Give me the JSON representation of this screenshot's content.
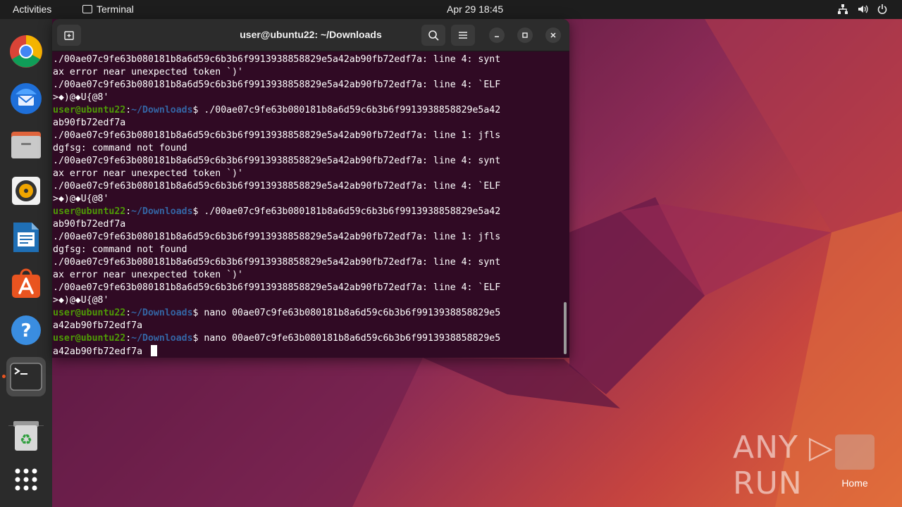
{
  "topbar": {
    "activities": "Activities",
    "app_name": "Terminal",
    "clock": "Apr 29  18:45"
  },
  "dock": {
    "items": [
      {
        "name": "chrome-icon"
      },
      {
        "name": "thunderbird-icon"
      },
      {
        "name": "files-icon"
      },
      {
        "name": "rhythmbox-icon"
      },
      {
        "name": "writer-icon"
      },
      {
        "name": "app-center-icon"
      },
      {
        "name": "help-icon"
      },
      {
        "name": "terminal-icon"
      },
      {
        "name": "trash-icon"
      },
      {
        "name": "show-apps-icon"
      }
    ]
  },
  "terminal": {
    "title": "user@ubuntu22: ~/Downloads",
    "lines": [
      {
        "t": "./00ae07c9fe63b080181b8a6d59c6b3b6f9913938858829e5a42ab90fb72edf7a: line 4: synt"
      },
      {
        "t": "ax error near unexpected token `)'"
      },
      {
        "t": "./00ae07c9fe63b080181b8a6d59c6b3b6f9913938858829e5a42ab90fb72edf7a: line 4: `ELF"
      },
      {
        "t": ">◆)@◆U{@8'"
      },
      {
        "user": "user@ubuntu22",
        "path": "~/Downloads",
        "t": "$ ./00ae07c9fe63b080181b8a6d59c6b3b6f9913938858829e5a42"
      },
      {
        "t": "ab90fb72edf7a"
      },
      {
        "t": "./00ae07c9fe63b080181b8a6d59c6b3b6f9913938858829e5a42ab90fb72edf7a: line 1: jfls"
      },
      {
        "t": "dgfsg: command not found"
      },
      {
        "t": "./00ae07c9fe63b080181b8a6d59c6b3b6f9913938858829e5a42ab90fb72edf7a: line 4: synt"
      },
      {
        "t": "ax error near unexpected token `)'"
      },
      {
        "t": "./00ae07c9fe63b080181b8a6d59c6b3b6f9913938858829e5a42ab90fb72edf7a: line 4: `ELF"
      },
      {
        "t": ">◆)@◆U{@8'"
      },
      {
        "user": "user@ubuntu22",
        "path": "~/Downloads",
        "t": "$ ./00ae07c9fe63b080181b8a6d59c6b3b6f9913938858829e5a42"
      },
      {
        "t": "ab90fb72edf7a"
      },
      {
        "t": "./00ae07c9fe63b080181b8a6d59c6b3b6f9913938858829e5a42ab90fb72edf7a: line 1: jfls"
      },
      {
        "t": "dgfsg: command not found"
      },
      {
        "t": "./00ae07c9fe63b080181b8a6d59c6b3b6f9913938858829e5a42ab90fb72edf7a: line 4: synt"
      },
      {
        "t": "ax error near unexpected token `)'"
      },
      {
        "t": "./00ae07c9fe63b080181b8a6d59c6b3b6f9913938858829e5a42ab90fb72edf7a: line 4: `ELF"
      },
      {
        "t": ">◆)@◆U{@8'"
      },
      {
        "user": "user@ubuntu22",
        "path": "~/Downloads",
        "t": "$ nano 00ae07c9fe63b080181b8a6d59c6b3b6f9913938858829e5"
      },
      {
        "t": "a42ab90fb72edf7a"
      },
      {
        "user": "user@ubuntu22",
        "path": "~/Downloads",
        "t": "$ nano 00ae07c9fe63b080181b8a6d59c6b3b6f9913938858829e5"
      },
      {
        "t": "a42ab90fb72edf7a ",
        "cursor": true
      }
    ]
  },
  "desktop": {
    "home_label": "Home",
    "watermark": "ANY ▷ RUN"
  },
  "colors": {
    "terminal_bg": "#300a24",
    "prompt_user": "#4e9a06",
    "prompt_path": "#3465a4",
    "accent": "#e95420"
  }
}
